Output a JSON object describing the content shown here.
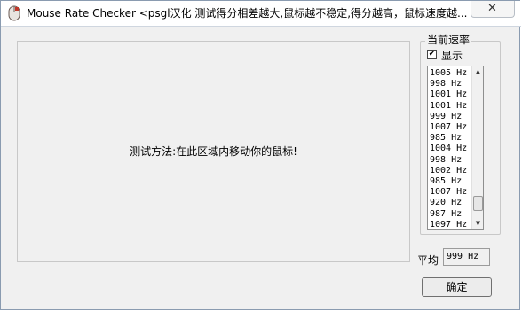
{
  "window": {
    "title": "Mouse Rate Checker <psgl汉化  测试得分相差越大,鼠标越不稳定,得分越高，鼠标速度越..."
  },
  "icons": {
    "app": "mouse-app-icon",
    "close": "close-icon",
    "check": "checkmark-icon",
    "scroll_up": "scroll-up-arrow-icon",
    "scroll_down": "scroll-down-arrow-icon"
  },
  "test_area": {
    "instruction": "测试方法:在此区域内移动你的鼠标!"
  },
  "rate_panel": {
    "group_label": "当前速率",
    "show_checkbox_label": "显示",
    "show_checked": true,
    "rates": [
      "1005 Hz",
      "998 Hz",
      "1001 Hz",
      "1001 Hz",
      "999 Hz",
      "1007 Hz",
      "985 Hz",
      "1004 Hz",
      "998 Hz",
      "1002 Hz",
      "985 Hz",
      "1007 Hz",
      "920 Hz",
      "987 Hz",
      "1097 Hz"
    ]
  },
  "average": {
    "label": "平均",
    "value": "999 Hz"
  },
  "buttons": {
    "ok": "确定",
    "close_glyph": "✕"
  }
}
